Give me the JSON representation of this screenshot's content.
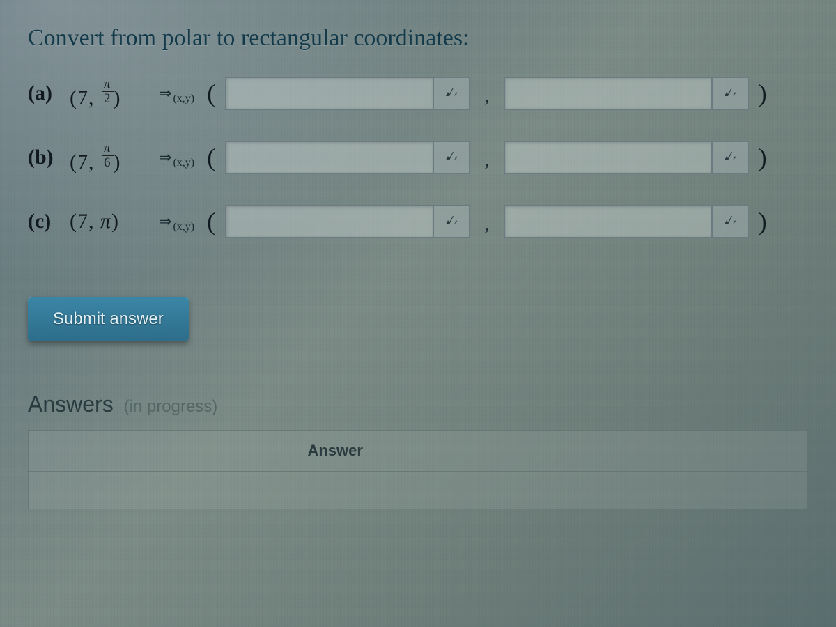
{
  "heading": "Convert from polar to rectangular coordinates:",
  "rows": [
    {
      "label": "(a)",
      "polar_r": "7",
      "polar_theta_numer": "π",
      "polar_theta_denom": "2",
      "polar_theta_is_fraction": true,
      "arrow": "⇒",
      "arrow_sub": "(x,y)",
      "open_paren": "(",
      "comma": ",",
      "close_paren": ")"
    },
    {
      "label": "(b)",
      "polar_r": "7",
      "polar_theta_numer": "π",
      "polar_theta_denom": "6",
      "polar_theta_is_fraction": true,
      "arrow": "⇒",
      "arrow_sub": "(x,y)",
      "open_paren": "(",
      "comma": ",",
      "close_paren": ")"
    },
    {
      "label": "(c)",
      "polar_r": "7",
      "polar_theta_numer": "π",
      "polar_theta_denom": "",
      "polar_theta_is_fraction": false,
      "arrow": "⇒",
      "arrow_sub": "(x,y)",
      "open_paren": "(",
      "comma": ",",
      "close_paren": ")"
    }
  ],
  "submit_label": "Submit answer",
  "answers": {
    "heading": "Answers",
    "status": "(in progress)",
    "columns": [
      "",
      "Answer"
    ],
    "rows": [
      {
        "label": "",
        "value": ""
      }
    ]
  },
  "icons": {
    "equation": "equation-editor-icon"
  },
  "colors": {
    "accent": "#2d6d8a",
    "text": "#1a2a30",
    "border": "#6a7c82"
  }
}
